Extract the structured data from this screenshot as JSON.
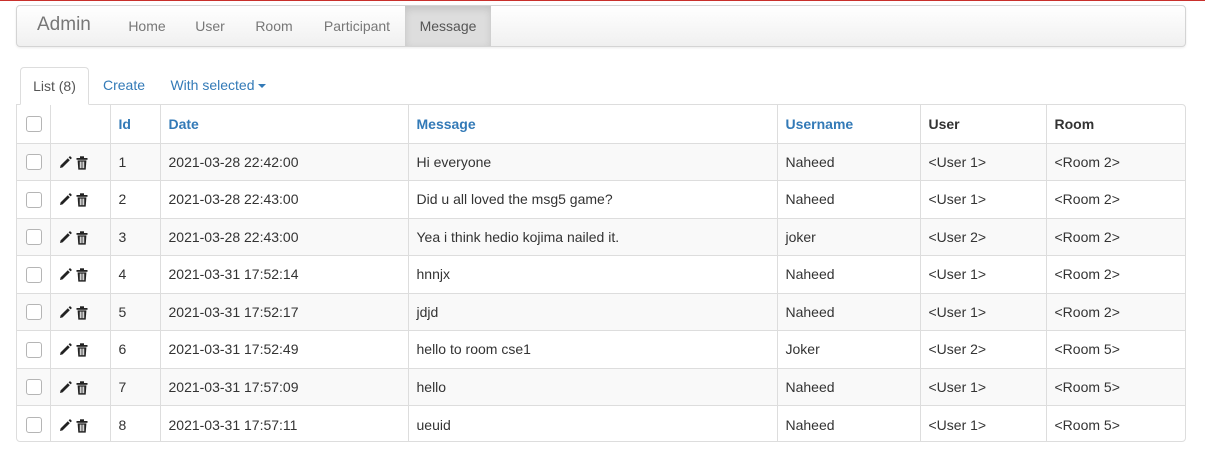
{
  "navbar": {
    "brand": "Admin",
    "items": [
      {
        "label": "Home"
      },
      {
        "label": "User"
      },
      {
        "label": "Room"
      },
      {
        "label": "Participant"
      },
      {
        "label": "Message",
        "active": true
      }
    ]
  },
  "tabs": {
    "list": "List (8)",
    "create": "Create",
    "with_selected": "With selected"
  },
  "table": {
    "columns": {
      "id": "Id",
      "date": "Date",
      "message": "Message",
      "username": "Username",
      "user": "User",
      "room": "Room"
    },
    "rows": [
      {
        "id": "1",
        "date": "2021-03-28 22:42:00",
        "message": "Hi everyone",
        "username": "Naheed",
        "user": "<User 1>",
        "room": "<Room 2>"
      },
      {
        "id": "2",
        "date": "2021-03-28 22:43:00",
        "message": "Did u all loved the msg5 game?",
        "username": "Naheed",
        "user": "<User 1>",
        "room": "<Room 2>"
      },
      {
        "id": "3",
        "date": "2021-03-28 22:43:00",
        "message": "Yea i think hedio kojima nailed it.",
        "username": "joker",
        "user": "<User 2>",
        "room": "<Room 2>"
      },
      {
        "id": "4",
        "date": "2021-03-31 17:52:14",
        "message": "hnnjx",
        "username": "Naheed",
        "user": "<User 1>",
        "room": "<Room 2>"
      },
      {
        "id": "5",
        "date": "2021-03-31 17:52:17",
        "message": "jdjd",
        "username": "Naheed",
        "user": "<User 1>",
        "room": "<Room 2>"
      },
      {
        "id": "6",
        "date": "2021-03-31 17:52:49",
        "message": "hello to room cse1",
        "username": "Joker",
        "user": "<User 2>",
        "room": "<Room 5>"
      },
      {
        "id": "7",
        "date": "2021-03-31 17:57:09",
        "message": "hello",
        "username": "Naheed",
        "user": "<User 1>",
        "room": "<Room 5>"
      },
      {
        "id": "8",
        "date": "2021-03-31 17:57:11",
        "message": "ueuid",
        "username": "Naheed",
        "user": "<User 1>",
        "room": "<Room 5>"
      }
    ]
  },
  "icons": {
    "edit": "pencil-icon",
    "delete": "trash-icon",
    "dropdown": "caret-down-icon"
  }
}
